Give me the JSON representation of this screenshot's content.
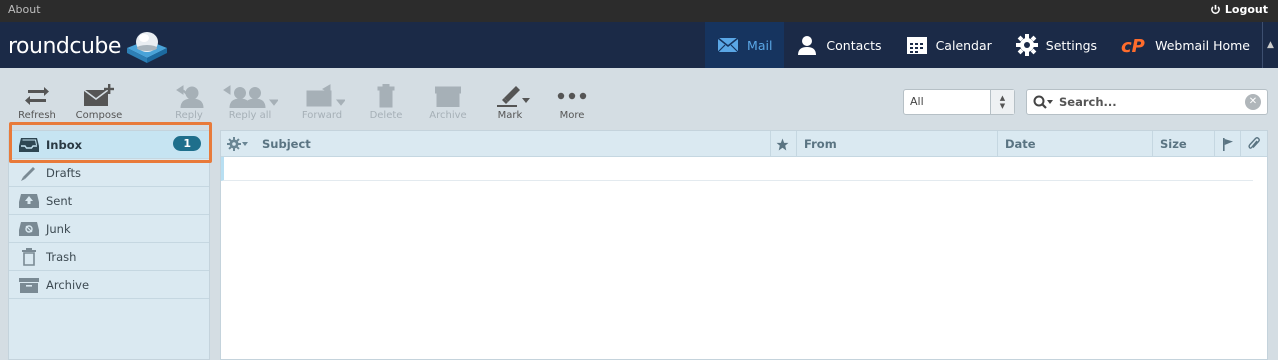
{
  "topbar": {
    "about_label": "About",
    "logout_label": "Logout"
  },
  "header": {
    "logo_text": "roundcube",
    "nav": [
      {
        "label": "Mail",
        "icon": "envelope-icon",
        "active": true
      },
      {
        "label": "Contacts",
        "icon": "person-icon"
      },
      {
        "label": "Calendar",
        "icon": "calendar-icon"
      },
      {
        "label": "Settings",
        "icon": "gear-icon"
      },
      {
        "label": "Webmail Home",
        "icon": "cpanel-icon"
      }
    ]
  },
  "toolbar": {
    "buttons": [
      {
        "label": "Refresh",
        "icon": "refresh-icon",
        "enabled": true
      },
      {
        "label": "Compose",
        "icon": "compose-icon",
        "enabled": true
      },
      {
        "label": "Reply",
        "icon": "reply-icon",
        "enabled": false
      },
      {
        "label": "Reply all",
        "icon": "reply-all-icon",
        "enabled": false
      },
      {
        "label": "Forward",
        "icon": "forward-icon",
        "enabled": false
      },
      {
        "label": "Delete",
        "icon": "trash-icon",
        "enabled": false
      },
      {
        "label": "Archive",
        "icon": "archive-icon",
        "enabled": false
      },
      {
        "label": "Mark",
        "icon": "mark-icon",
        "enabled": true
      },
      {
        "label": "More",
        "icon": "more-icon",
        "enabled": true
      }
    ],
    "filter_value": "All",
    "search_placeholder": "Search..."
  },
  "folders": [
    {
      "label": "Inbox",
      "icon": "inbox-icon",
      "selected": true,
      "unread": "1"
    },
    {
      "label": "Drafts",
      "icon": "pencil-icon"
    },
    {
      "label": "Sent",
      "icon": "sent-icon"
    },
    {
      "label": "Junk",
      "icon": "junk-icon"
    },
    {
      "label": "Trash",
      "icon": "trash-icon"
    },
    {
      "label": "Archive",
      "icon": "archive-icon"
    }
  ],
  "message_list": {
    "columns": {
      "subject": "Subject",
      "from": "From",
      "date": "Date",
      "size": "Size"
    }
  },
  "colors": {
    "header_bg": "#1b2a47",
    "highlight": "#e87a3a",
    "accent": "#5aa7e6",
    "badge": "#1e6f8c"
  }
}
